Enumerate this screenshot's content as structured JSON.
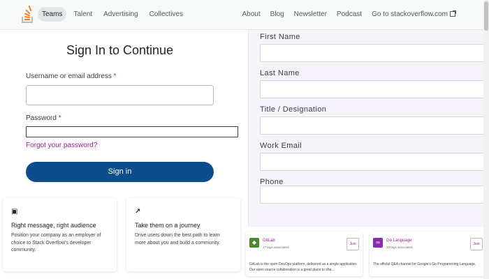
{
  "nav": {
    "left": [
      "Teams",
      "Talent",
      "Advertising",
      "Collectives"
    ],
    "right": [
      "About",
      "Blog",
      "Newsletter",
      "Podcast",
      "Go to stackoverflow.com"
    ],
    "active": "Teams",
    "external_icon": "external-link-icon",
    "logo_icon": "stack-logo-icon"
  },
  "signin": {
    "title": "Sign In to Continue",
    "username_label": "Username or email address",
    "password_label": "Password",
    "required_mark": "*",
    "username_value": "",
    "password_value": "",
    "forgot": "Forgot your password?",
    "button": "Sign in"
  },
  "features": [
    {
      "icon": "message-icon",
      "glyph": "▣",
      "title": "Right message, right audience",
      "desc": "Position your company as an employer of choice to Stack Overflow's developer community."
    },
    {
      "icon": "trend-arrow-icon",
      "glyph": "↗",
      "title": "Take them on a journey",
      "desc": "Drive users down the best path to learn more about you and build a community."
    }
  ],
  "form": {
    "fields": [
      {
        "label": "First Name",
        "value": ""
      },
      {
        "label": "Last Name",
        "value": ""
      },
      {
        "label": "Title / Designation",
        "value": ""
      },
      {
        "label": "Work Email",
        "value": ""
      },
      {
        "label": "Phone",
        "value": ""
      }
    ]
  },
  "collectives": [
    {
      "name": "GitLab",
      "meta": "17 tags associated",
      "join": "Join",
      "desc": "GitLab is the open DevOps platform, delivered as a single application. Our open source collaboration is a great place to sha...",
      "icon": "gitlab-icon",
      "glyph": "◆",
      "color": "#4a8a2a"
    },
    {
      "name": "Go Language",
      "meta": "15 tags associated",
      "join": "Join",
      "desc": "The official Q&A channel for Google's Go Programming Language.",
      "icon": "go-language-icon",
      "glyph": "∞",
      "color": "#8a2cb0"
    }
  ],
  "colors": {
    "accent": "#0d4d8c",
    "link": "#9c2093",
    "panel": "#f6f3fb"
  }
}
